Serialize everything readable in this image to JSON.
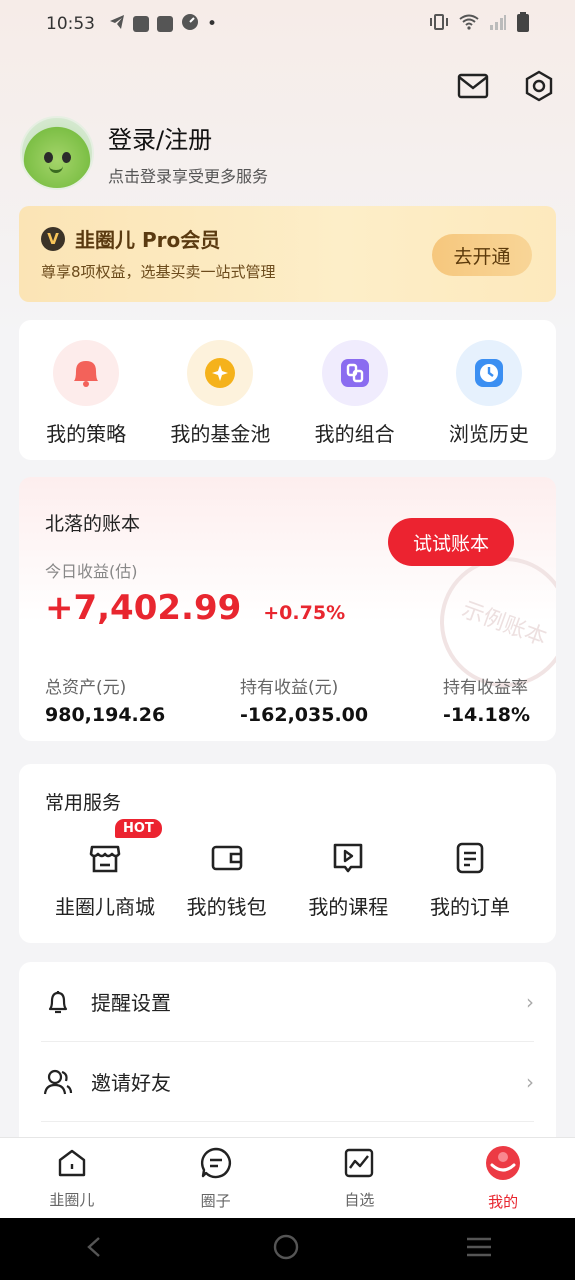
{
  "status_bar": {
    "time": "10:53",
    "dot": "•"
  },
  "header": {
    "icons": [
      "mail-icon",
      "settings-icon"
    ]
  },
  "profile": {
    "title": "登录/注册",
    "subtitle": "点击登录享受更多服务"
  },
  "pro": {
    "badge": "V",
    "title": "韭圈儿 Pro会员",
    "subtitle": "尊享8项权益，选基买卖一站式管理",
    "button": "去开通"
  },
  "quick_links": [
    {
      "label": "我的策略",
      "icon": "bell-icon",
      "color": "#f0564c"
    },
    {
      "label": "我的基金池",
      "icon": "coin-icon",
      "color": "#f5b21b"
    },
    {
      "label": "我的组合",
      "icon": "portfolio-icon",
      "color": "#8a6cf0"
    },
    {
      "label": "浏览历史",
      "icon": "clock-icon",
      "color": "#3b8ff2"
    }
  ],
  "ledger": {
    "title": "北落的账本",
    "button": "试试账本",
    "today_label": "今日收益(估)",
    "today_value": "+7,402.99",
    "today_pct": "+0.75%",
    "stamp": "示例账本",
    "stats": [
      {
        "label": "总资产(元)",
        "value": "980,194.26"
      },
      {
        "label": "持有收益(元)",
        "value": "-162,035.00"
      },
      {
        "label": "持有收益率",
        "value": "-14.18%"
      }
    ]
  },
  "services": {
    "title": "常用服务",
    "hot": "HOT",
    "items": [
      {
        "label": "韭圈儿商城",
        "icon": "shop-icon"
      },
      {
        "label": "我的钱包",
        "icon": "wallet-icon"
      },
      {
        "label": "我的课程",
        "icon": "course-icon"
      },
      {
        "label": "我的订单",
        "icon": "order-icon"
      }
    ]
  },
  "settings": [
    {
      "label": "提醒设置",
      "icon": "bell-outline-icon"
    },
    {
      "label": "邀请好友",
      "icon": "friends-icon"
    }
  ],
  "tabs": [
    {
      "label": "韭圈儿",
      "icon": "home-icon"
    },
    {
      "label": "圈子",
      "icon": "chat-icon"
    },
    {
      "label": "自选",
      "icon": "chart-icon"
    },
    {
      "label": "我的",
      "icon": "profile-icon",
      "active": true
    }
  ],
  "colors": {
    "accent": "#e8262f",
    "gold": "#f6c77d"
  }
}
